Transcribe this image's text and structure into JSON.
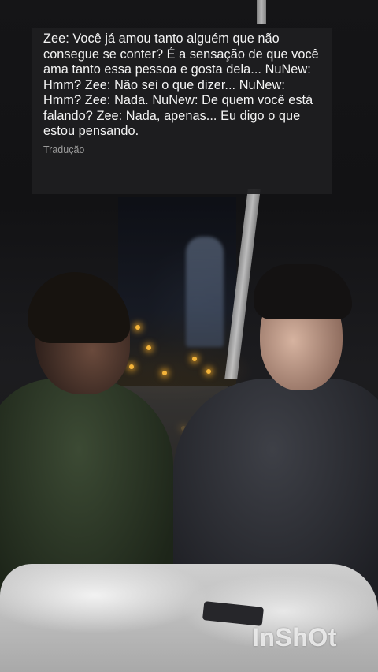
{
  "caption": {
    "text": "Zee: Você já amou tanto alguém que não consegue se conter? É a sensação de que você ama tanto essa pessoa e gosta dela... NuNew: Hmm? Zee: Não sei o que dizer... NuNew: Hmm? Zee: Nada. NuNew: De quem você está falando? Zee: Nada, apenas... Eu digo o que estou pensando.",
    "label": "Tradução"
  },
  "watermark": {
    "text": "InShOt"
  },
  "colors": {
    "caption_bg": "#1e1e20",
    "caption_text": "#f4f4f4",
    "caption_label": "#9b9b9b"
  }
}
